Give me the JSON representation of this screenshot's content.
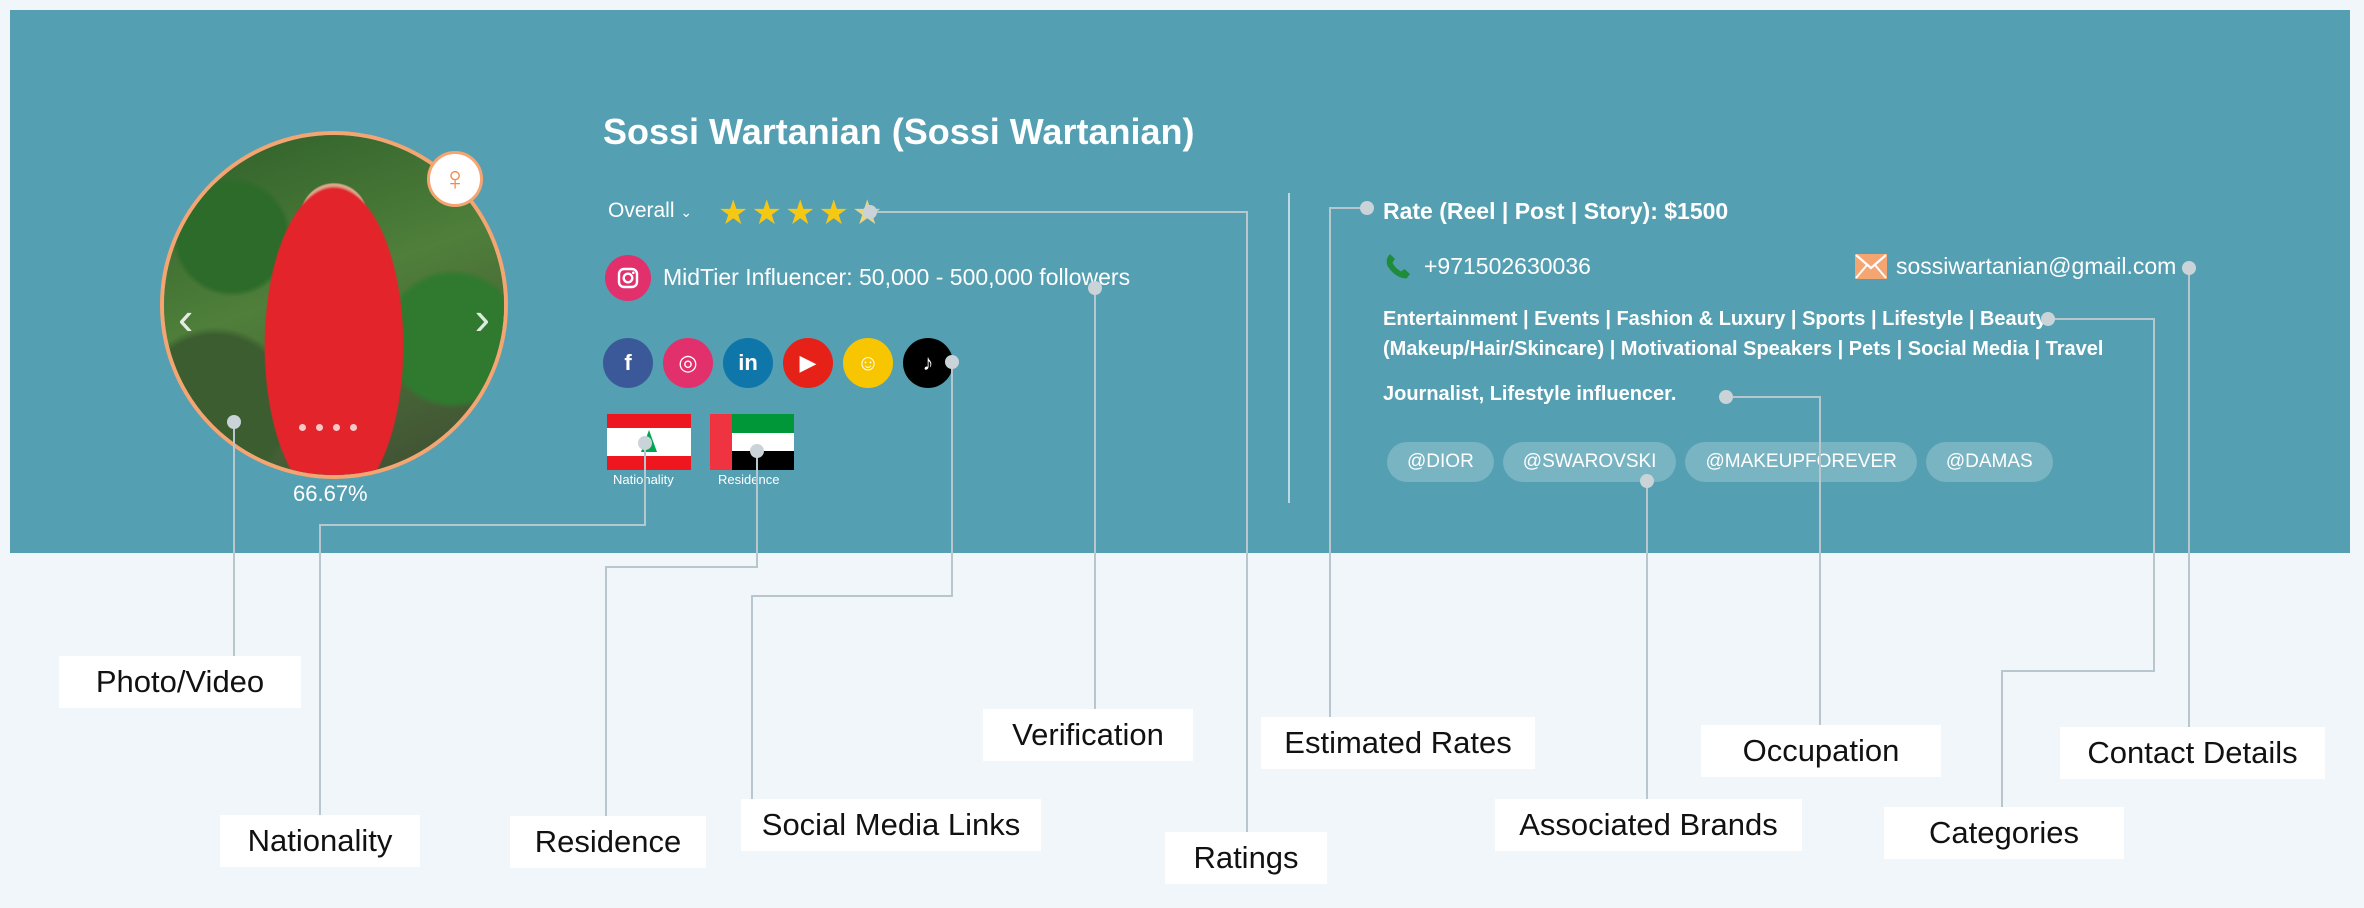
{
  "profile": {
    "name": "Sossi Wartanian (Sossi Wartanian)",
    "completion": "66.67%",
    "gender_icon": "female-sign-icon",
    "rating_label": "Overall",
    "rating_stars": 4.5,
    "tier": "MidTier Influencer: 50,000 - 500,000 followers",
    "social_links": [
      {
        "icon": "facebook-icon",
        "glyph": "f",
        "color": "#3b5998"
      },
      {
        "icon": "instagram-icon",
        "glyph": "◎",
        "color": "#e1306c"
      },
      {
        "icon": "linkedin-icon",
        "glyph": "in",
        "color": "#0e76a8"
      },
      {
        "icon": "youtube-icon",
        "glyph": "▶",
        "color": "#e62117"
      },
      {
        "icon": "snapchat-icon",
        "glyph": "☺",
        "color": "#f7c600"
      },
      {
        "icon": "tiktok-icon",
        "glyph": "♪",
        "color": "#000000"
      }
    ],
    "nationality_caption": "Nationality",
    "residence_caption": "Residence",
    "rate": "Rate (Reel | Post | Story): $1500",
    "phone": "+971502630036",
    "email": "sossiwartanian@gmail.com",
    "categories_line1": "Entertainment | Events | Fashion & Luxury | Sports | Lifestyle | Beauty",
    "categories_line2": "(Makeup/Hair/Skincare) | Motivational Speakers | Pets | Social Media | Travel",
    "occupation": "Journalist, Lifestyle influencer.",
    "brands": [
      "@DIOR",
      "@SWAROVSKI",
      "@MAKEUPFOREVER",
      "@DAMAS"
    ]
  },
  "callouts": {
    "photo": "Photo/Video",
    "nationality": "Nationality",
    "residence": "Residence",
    "social": "Social Media Links",
    "verification": "Verification",
    "ratings": "Ratings",
    "rates": "Estimated Rates",
    "brands": "Associated Brands",
    "occupation": "Occupation",
    "categories": "Categories",
    "contact": "Contact Details"
  },
  "colors": {
    "panel": "#549fb2",
    "accent": "#f4a571",
    "star": "#f6c814"
  }
}
